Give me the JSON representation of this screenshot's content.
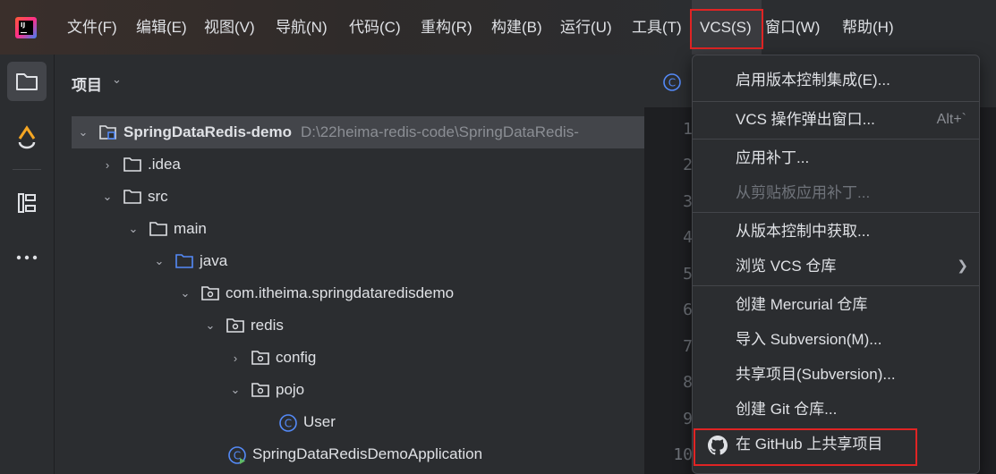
{
  "menubar": {
    "items": [
      {
        "label": "文件(F)"
      },
      {
        "label": "编辑(E)"
      },
      {
        "label": "视图(V)"
      },
      {
        "label": "导航(N)"
      },
      {
        "label": "代码(C)"
      },
      {
        "label": "重构(R)"
      },
      {
        "label": "构建(B)"
      },
      {
        "label": "运行(U)"
      },
      {
        "label": "工具(T)"
      },
      {
        "label": "VCS(S)"
      },
      {
        "label": "窗口(W)"
      },
      {
        "label": "帮助(H)"
      }
    ],
    "active_index": 9
  },
  "project_panel": {
    "title": "项目",
    "tree": [
      {
        "label": "SpringDataRedis-demo",
        "path": "D:\\22heima-redis-code\\SpringDataRedis-"
      },
      {
        "label": ".idea"
      },
      {
        "label": "src"
      },
      {
        "label": "main"
      },
      {
        "label": "java"
      },
      {
        "label": "com.itheima.springdataredisdemo"
      },
      {
        "label": "redis"
      },
      {
        "label": "config"
      },
      {
        "label": "pojo"
      },
      {
        "label": "User"
      },
      {
        "label": "SpringDataRedisDemoApplication"
      }
    ]
  },
  "editor": {
    "line_numbers": [
      "1",
      "2",
      "3",
      "4",
      "5",
      "6",
      "7",
      "8",
      "9",
      "10"
    ]
  },
  "vcs_menu": {
    "items": [
      {
        "label": "启用版本控制集成(E)..."
      },
      {
        "label": "VCS 操作弹出窗口...",
        "shortcut": "Alt+`"
      },
      {
        "label": "应用补丁..."
      },
      {
        "label": "从剪贴板应用补丁..."
      },
      {
        "label": "从版本控制中获取..."
      },
      {
        "label": "浏览 VCS 仓库"
      },
      {
        "label": "创建 Mercurial 仓库"
      },
      {
        "label": "导入 Subversion(M)..."
      },
      {
        "label": "共享项目(Subversion)..."
      },
      {
        "label": "创建 Git 仓库..."
      },
      {
        "label": "在 GitHub 上共享项目"
      }
    ]
  },
  "colors": {
    "highlight_box": "#e02424",
    "accent_blue": "#548af7"
  }
}
